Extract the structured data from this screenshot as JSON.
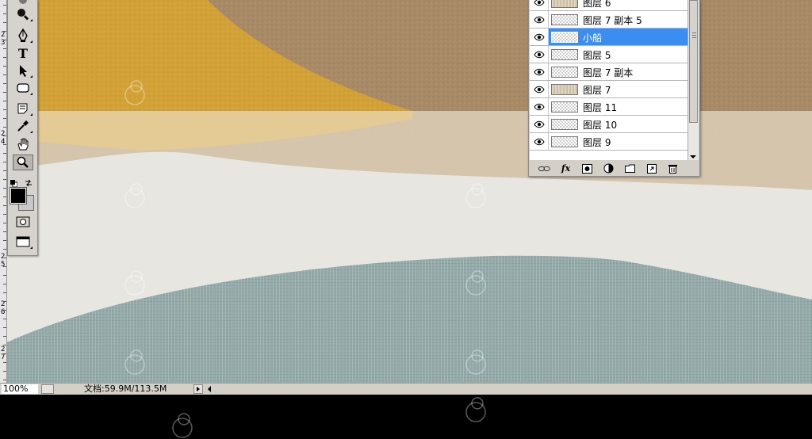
{
  "ruler": {
    "marks": [
      {
        "a": "2",
        "b": "3"
      },
      {
        "a": "2",
        "b": "4"
      },
      {
        "a": "2",
        "b": "5"
      },
      {
        "a": "2",
        "b": "6"
      },
      {
        "a": "2",
        "b": "7"
      }
    ]
  },
  "layers": {
    "rows": [
      {
        "name": "图层 6",
        "selected": false,
        "thumb": "warm"
      },
      {
        "name": "图层 7 副本 5",
        "selected": false,
        "thumb": "plain"
      },
      {
        "name": "小船",
        "selected": true,
        "thumb": "plain"
      },
      {
        "name": "图层 5",
        "selected": false,
        "thumb": "plain"
      },
      {
        "name": "图层 7 副本",
        "selected": false,
        "thumb": "plain"
      },
      {
        "name": "图层 7",
        "selected": false,
        "thumb": "warm"
      },
      {
        "name": "图层 11",
        "selected": false,
        "thumb": "plain"
      },
      {
        "name": "图层 10",
        "selected": false,
        "thumb": "plain"
      },
      {
        "name": "图层 9",
        "selected": false,
        "thumb": "plain"
      }
    ],
    "footer_fx": "fx"
  },
  "status": {
    "zoom": "100%",
    "doc_size": "文档:59.9M/113.5M"
  },
  "colors": {
    "selection": "#3b8ef0",
    "foreground": "#000000",
    "background": "#c8c8c8"
  }
}
